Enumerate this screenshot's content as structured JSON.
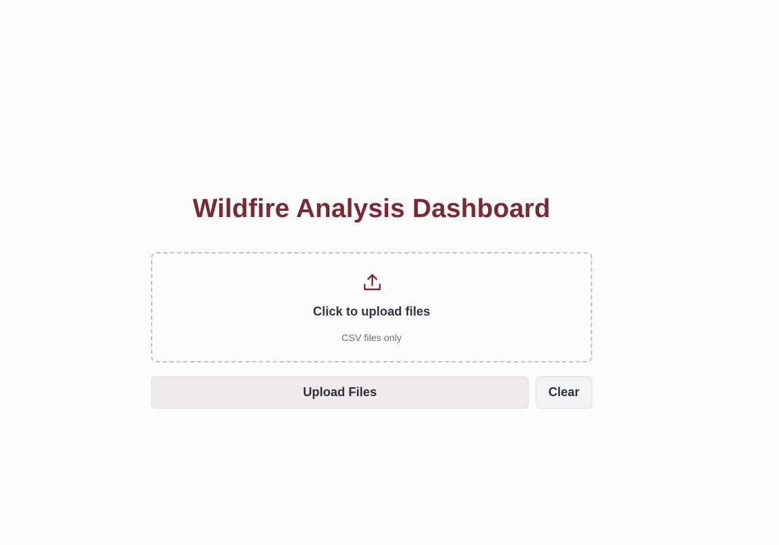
{
  "header": {
    "title": "Wildfire Analysis Dashboard"
  },
  "dropzone": {
    "icon": "upload-icon",
    "title": "Click to upload files",
    "subtitle": "CSV files only"
  },
  "actions": {
    "upload_label": "Upload Files",
    "clear_label": "Clear"
  },
  "colors": {
    "accent": "#7a2a33",
    "dropzone_border": "#d8b7bd",
    "upload_button_bg": "#efe9e9",
    "clear_button_bg": "#f2f3f5"
  }
}
